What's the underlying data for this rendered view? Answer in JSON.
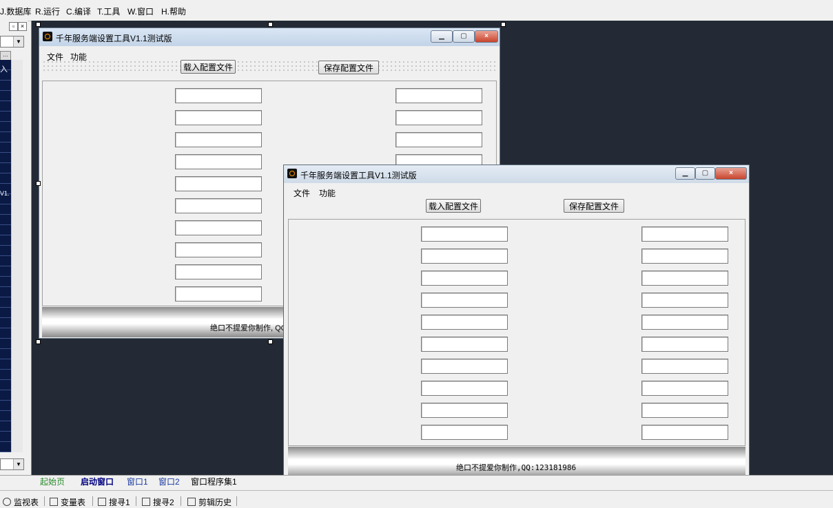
{
  "main_menu": [
    "J.数据库",
    "R.运行",
    "C.编译",
    "T.工具",
    "W.窗口",
    "H.帮助"
  ],
  "left_panel": {
    "text_ru": "入",
    "text_v1": "V1."
  },
  "window_back": {
    "title": "千年服务端设置工具V1.1测试版",
    "menu": [
      "文件",
      "功能"
    ],
    "load_button": "载入配置文件",
    "save_button": "保存配置文件",
    "footer_text": "绝口不提爱你制作, QQ"
  },
  "window_front": {
    "title": "千年服务端设置工具V1.1测试版",
    "menu": [
      "文件",
      "功能"
    ],
    "load_button": "载入配置文件",
    "save_button": "保存配置文件",
    "footer_text": "绝口不提爱你制作,QQ:123181986"
  },
  "tabs": [
    "起始页",
    "启动窗口",
    "窗口1",
    "窗口2",
    "窗口程序集1"
  ],
  "bottom_tools": [
    "监视表",
    "变量表",
    "搜寻1",
    "搜寻2",
    "剪辑历史"
  ],
  "icons": {
    "app": "app-icon",
    "minimize": "minimize-icon",
    "maximize": "maximize-icon",
    "close": "close-icon"
  }
}
